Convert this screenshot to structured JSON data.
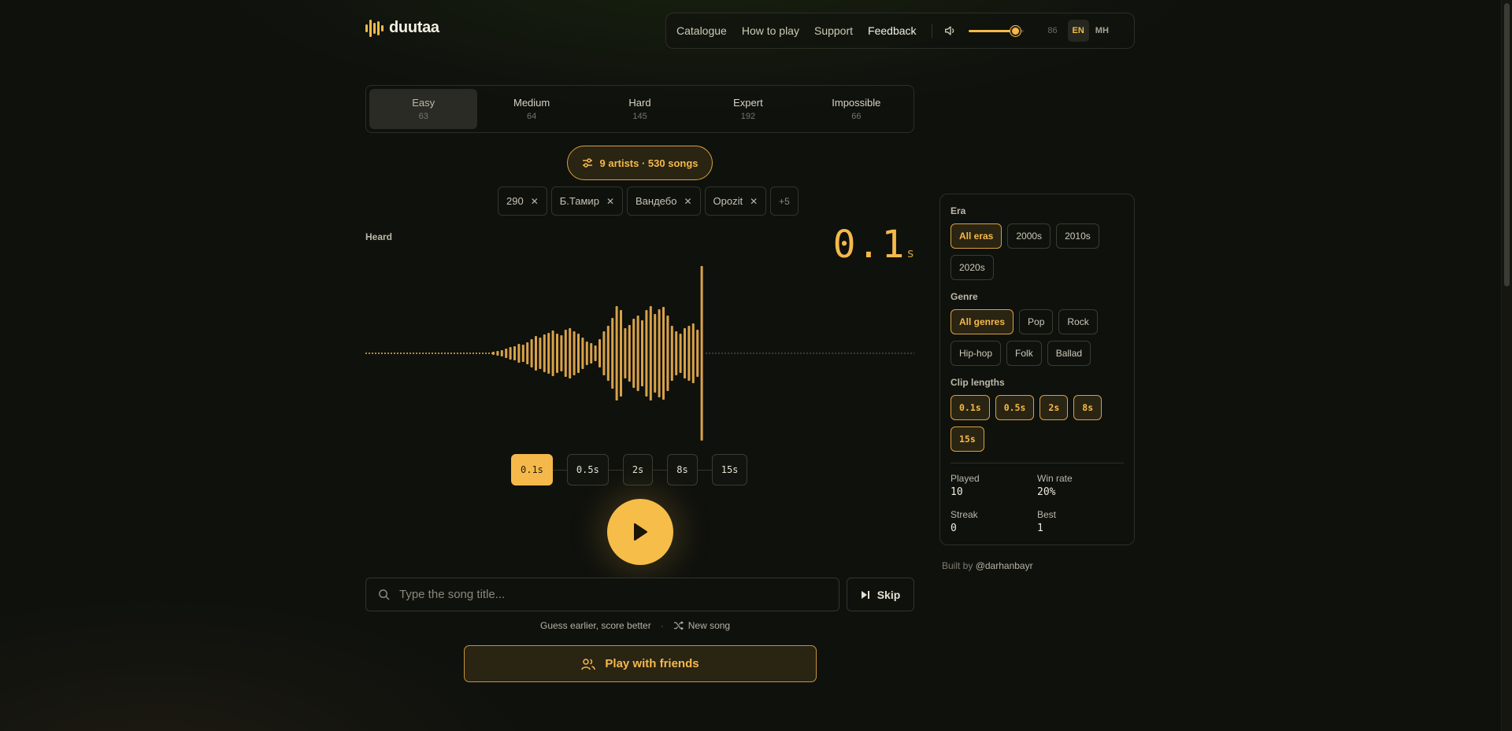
{
  "brand": {
    "name": "duutaa"
  },
  "nav": {
    "links": [
      "Catalogue",
      "How to play",
      "Support",
      "Feedback"
    ],
    "volume_value": "86",
    "volume_level": 0.86,
    "languages": [
      "EN",
      "MH"
    ]
  },
  "difficulty": {
    "tabs": [
      {
        "label": "Easy",
        "count": "63"
      },
      {
        "label": "Medium",
        "count": "64"
      },
      {
        "label": "Hard",
        "count": "145"
      },
      {
        "label": "Expert",
        "count": "192"
      },
      {
        "label": "Impossible",
        "count": "66"
      }
    ],
    "selected": "Easy"
  },
  "filter": {
    "summary": "9 artists · 530 songs",
    "chips": [
      "290",
      "Б.Тамир",
      "Вандебо",
      "Opozit"
    ],
    "more": "+5"
  },
  "player": {
    "heard_label": "Heard",
    "time_value": "0.1",
    "time_unit": "s",
    "steps": [
      "0.1s",
      "0.5s",
      "2s",
      "8s",
      "15s"
    ],
    "active_step": "0.1s"
  },
  "guess": {
    "placeholder": "Type the song title...",
    "skip_label": "Skip",
    "hint": "Guess earlier, score better",
    "new_song": "New song",
    "friends_label": "Play with friends"
  },
  "panel": {
    "era_label": "Era",
    "eras": [
      "All eras",
      "2000s",
      "2010s",
      "2020s"
    ],
    "genre_label": "Genre",
    "genres": [
      "All genres",
      "Pop",
      "Rock",
      "Hip-hop",
      "Folk",
      "Ballad"
    ],
    "clip_label": "Clip lengths",
    "clips": [
      "0.1s",
      "0.5s",
      "2s",
      "8s",
      "15s"
    ],
    "stats": [
      {
        "label": "Played",
        "value": "10"
      },
      {
        "label": "Win rate",
        "value": "20%"
      },
      {
        "label": "Streak",
        "value": "0"
      },
      {
        "label": "Best",
        "value": "1"
      }
    ]
  },
  "credit": {
    "prefix": "Built by",
    "handle": "@darhanbayr"
  },
  "colors": {
    "accent": "#f5b94b",
    "background": "#0f110d"
  }
}
